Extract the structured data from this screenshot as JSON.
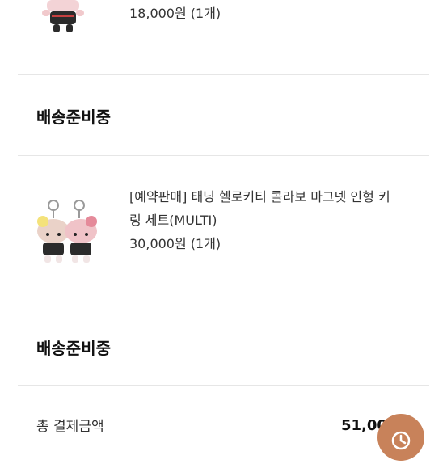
{
  "items": [
    {
      "price_qty": "18,000원 (1개)"
    },
    {
      "name": "[예약판매] 태닝 헬로키티 콜라보 마그넷 인형 키링 세트(MULTI)",
      "price_qty": "30,000원 (1개)",
      "status": "배송준비중"
    }
  ],
  "first_status": "배송준비중",
  "total": {
    "label": "총 결제금액",
    "value": "51,000원"
  },
  "fab": {
    "icon": "clock-icon"
  }
}
